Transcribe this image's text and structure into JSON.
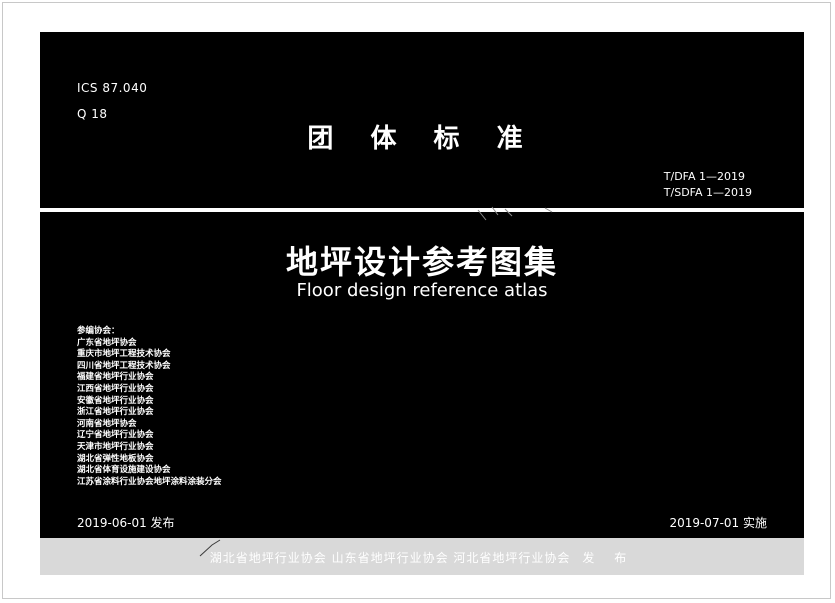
{
  "header": {
    "ics": "ICS 87.040",
    "q_code": "Q 18",
    "category_title": "团 体 标 准",
    "standard_codes": [
      "T/DFA 1—2019",
      "T/SDFA 1—2019"
    ]
  },
  "document": {
    "title_cn": "地坪设计参考图集",
    "title_en": "Floor design reference atlas"
  },
  "organizations": {
    "heading": "参编协会：",
    "items": [
      "广东省地坪协会",
      "重庆市地坪工程技术协会",
      "四川省地坪工程技术协会",
      "福建省地坪行业协会",
      "江西省地坪行业协会",
      "安徽省地坪行业协会",
      "浙江省地坪行业协会",
      "河南省地坪协会",
      "辽宁省地坪行业协会",
      "天津市地坪行业协会",
      "湖北省弹性地板协会",
      "湖北省体育设施建设协会",
      "江苏省涂料行业协会地坪涂料涂装分会"
    ]
  },
  "dates": {
    "published": "2019-06-01 发布",
    "implemented": "2019-07-01 实施"
  },
  "footer": {
    "publishers": "湖北省地坪行业协会  山东省地坪行业协会  河北省地坪行业协会",
    "publish_word": "发 布"
  },
  "colors": {
    "panel": "#000000",
    "footer_band": "#d9d9d9",
    "text": "#ffffff"
  }
}
